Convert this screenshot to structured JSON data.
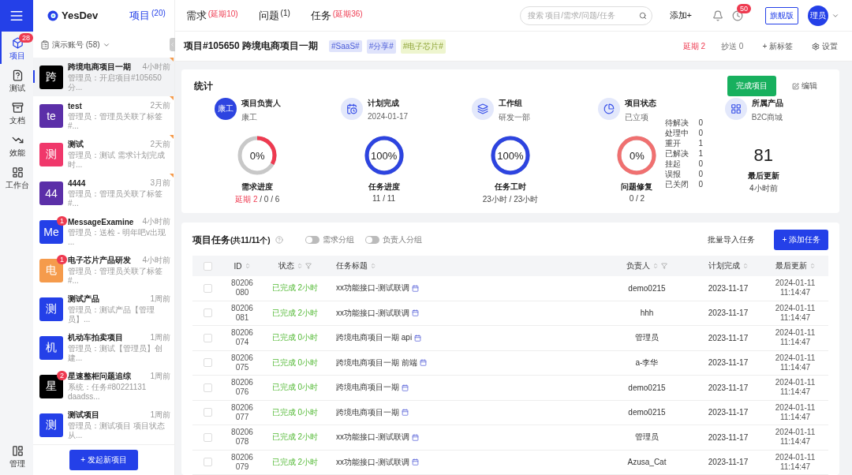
{
  "rail": {
    "items": [
      {
        "label": "项目",
        "selected": true,
        "badge": "28"
      },
      {
        "label": "测试",
        "selected": false
      },
      {
        "label": "文档",
        "selected": false
      },
      {
        "label": "效能",
        "selected": false
      },
      {
        "label": "工作台",
        "selected": false
      }
    ],
    "bottom": {
      "label": "管理"
    }
  },
  "logo": "YesDev",
  "nav_tabs": [
    {
      "label": "项目",
      "count": "(20)",
      "selected": true,
      "alert": false
    },
    {
      "label": "需求",
      "count": "(延期10)",
      "selected": false,
      "alert": true
    },
    {
      "label": "问题",
      "count": "(1)",
      "selected": false,
      "alert": false
    },
    {
      "label": "任务",
      "count": "(延期36)",
      "selected": false,
      "alert": true
    }
  ],
  "search": {
    "placeholder": "搜索 项目/需求/问题/任务"
  },
  "add_button": "添加+",
  "clock_badge": "50",
  "edition_button": "旗舰版",
  "user_avatar": "理员",
  "sidebar": {
    "account": "演示账号 (58)",
    "new_button": "+ 发起新项目",
    "projects": [
      {
        "avatar": "跨",
        "color": "#000000",
        "name": "跨境电商项目一期",
        "time": "4小时前",
        "preview": "管理员：开启项目#105650分...",
        "selected": true,
        "flagged": true
      },
      {
        "avatar": "te",
        "color": "#5b2fa8",
        "name": "test",
        "time": "2天前",
        "preview": "管理员：管理员关联了标签#...",
        "selected": false,
        "flagged": true
      },
      {
        "avatar": "测",
        "color": "#f0386b",
        "name": "测试",
        "time": "2天前",
        "preview": "管理员：测试 需求计划完成时...",
        "selected": false,
        "flagged": true
      },
      {
        "avatar": "44",
        "color": "#5b2fa8",
        "name": "4444",
        "time": "3月前",
        "preview": "管理员：管理员关联了标签#...",
        "selected": false,
        "flagged": true
      },
      {
        "avatar": "Me",
        "color": "#2440e8",
        "name": "MessageExamine",
        "time": "4小时前",
        "preview": "管理员：送检 - 明年吧v出现 ...",
        "selected": false,
        "flagged": false,
        "badge": "1"
      },
      {
        "avatar": "电",
        "color": "#f59b4c",
        "name": "电子芯片产品研发",
        "time": "4小时前",
        "preview": "管理员：管理员关联了标签#...",
        "selected": false,
        "flagged": false,
        "badge": "1"
      },
      {
        "avatar": "测",
        "color": "#2440e8",
        "name": "测试产品",
        "time": "1周前",
        "preview": "管理员：测试产品【管理员】...",
        "selected": false,
        "flagged": false
      },
      {
        "avatar": "机",
        "color": "#2440e8",
        "name": "机动车拍卖项目",
        "time": "1周前",
        "preview": "管理员：测试【管理员】创建...",
        "selected": false,
        "flagged": false
      },
      {
        "avatar": "星",
        "color": "#000000",
        "name": "星速整柜问题追综",
        "time": "1周前",
        "preview": "系统：任务#80221131 daadss...",
        "selected": false,
        "flagged": false,
        "badge": "2"
      },
      {
        "avatar": "测",
        "color": "#2440e8",
        "name": "测试项目",
        "time": "1周前",
        "preview": "管理员：测试项目 项目状态从...",
        "selected": false,
        "flagged": false
      }
    ]
  },
  "project_bar": {
    "title": "项目#105650 跨境电商项目一期",
    "tags": [
      {
        "label": "#SaaS#",
        "color": "#dfe3fb"
      },
      {
        "label": "#分享#",
        "color": "#dfe3fb"
      },
      {
        "label": "#电子芯片#",
        "color": "#eef5cf"
      }
    ],
    "delay": "延期 2",
    "cc": "抄送 0",
    "new_tag": "+ 新标签",
    "settings": "设置"
  },
  "stats": {
    "title": "统计",
    "complete_button": "完成项目",
    "edit_button": "编辑",
    "info": [
      {
        "kind": "avatar",
        "avatar": "康工",
        "label": "项目负责人",
        "value": "康工"
      },
      {
        "kind": "icon",
        "label": "计划完成",
        "value": "2024-01-17"
      },
      {
        "kind": "icon",
        "label": "工作组",
        "value": "研发一部"
      },
      {
        "kind": "icon",
        "label": "项目状态",
        "value": "已立项"
      },
      {
        "kind": "icon",
        "label": "所属产品",
        "value": "B2C商城"
      }
    ],
    "metrics": [
      {
        "kind": "ring",
        "percent": "0%",
        "level": 0.33,
        "color": "#ee3a50",
        "label": "需求进度",
        "detail_alert": "延期 2",
        "detail": "/ 0 / 6"
      },
      {
        "kind": "ring",
        "percent": "100%",
        "level": 1,
        "color": "#2d44e0",
        "label": "任务进度",
        "detail": "11 / 11"
      },
      {
        "kind": "ring",
        "percent": "100%",
        "level": 1,
        "color": "#2d44e0",
        "label": "任务工时",
        "detail": "23小时 / 23小时"
      },
      {
        "kind": "ring",
        "percent": "0%",
        "level": 1,
        "color": "#f07070",
        "label": "问题修复",
        "detail": "0 / 2",
        "breakdown": [
          {
            "label": "待解决",
            "value": "0"
          },
          {
            "label": "处理中",
            "value": "0"
          },
          {
            "label": "重开",
            "value": "1"
          },
          {
            "label": "已解决",
            "value": "1"
          },
          {
            "label": "挂起",
            "value": "0"
          },
          {
            "label": "误报",
            "value": "0"
          },
          {
            "label": "已关闭",
            "value": "0"
          }
        ]
      },
      {
        "kind": "number",
        "value": "81",
        "label": "最后更新",
        "detail": "4小时前"
      }
    ]
  },
  "tasks": {
    "all_checked": false,
    "title": "项目任务",
    "count": "(共11/11个)",
    "toggles": [
      {
        "label": "需求分组",
        "on": false
      },
      {
        "label": "负责人分组",
        "on": false
      }
    ],
    "import_button": "批量导入任务",
    "add_button": "+ 添加任务",
    "columns": [
      "ID",
      "状态",
      "任务标题",
      "负责人",
      "计划完成",
      "最后更新"
    ],
    "rows": [
      {
        "id": "80206080",
        "status": "已完成 2小时",
        "title": "xx功能接口-测试联调",
        "owner": "demo0215",
        "plan": "2023-11-17",
        "updated": "2024-01-11 11:14:47",
        "checked": false
      },
      {
        "id": "80206081",
        "status": "已完成 2小时",
        "title": "xx功能接口-测试联调",
        "owner": "hhh",
        "plan": "2023-11-17",
        "updated": "2024-01-11 11:14:47",
        "checked": false
      },
      {
        "id": "80206074",
        "status": "已完成 0小时",
        "title": "跨境电商项目一期 api",
        "owner": "管理员",
        "plan": "2023-11-17",
        "updated": "2024-01-11 11:14:47",
        "checked": false
      },
      {
        "id": "80206075",
        "status": "已完成 0小时",
        "title": "跨境电商项目一期 前端",
        "owner": "a-李华",
        "plan": "2023-11-17",
        "updated": "2024-01-11 11:14:47",
        "checked": false
      },
      {
        "id": "80206076",
        "status": "已完成 0小时",
        "title": "跨境电商项目一期",
        "owner": "demo0215",
        "plan": "2023-11-17",
        "updated": "2024-01-11 11:14:47",
        "checked": false
      },
      {
        "id": "80206077",
        "status": "已完成 0小时",
        "title": "跨境电商项目一期",
        "owner": "demo0215",
        "plan": "2023-11-17",
        "updated": "2024-01-11 11:14:47",
        "checked": false
      },
      {
        "id": "80206078",
        "status": "已完成 2小时",
        "title": "xx功能接口-测试联调",
        "owner": "管理员",
        "plan": "2023-11-17",
        "updated": "2024-01-11 11:14:47",
        "checked": false
      },
      {
        "id": "80206079",
        "status": "已完成 2小时",
        "title": "xx功能接口-测试联调",
        "owner": "Azusa_Cat",
        "plan": "2023-11-17",
        "updated": "2024-01-11 11:14:47",
        "checked": false
      }
    ]
  }
}
